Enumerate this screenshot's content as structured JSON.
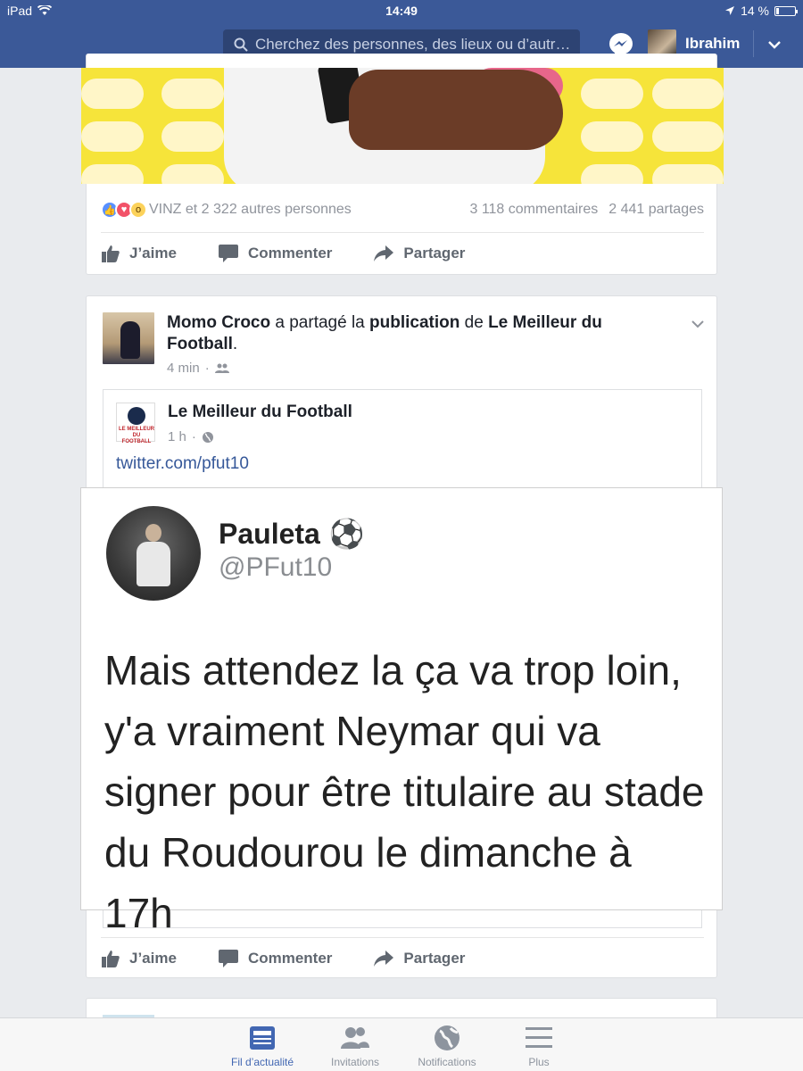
{
  "status_bar": {
    "device": "iPad",
    "time": "14:49",
    "battery": "14 %",
    "battery_level": 0.14
  },
  "nav": {
    "search_placeholder": "Cherchez des personnes, des lieux ou d’autr…",
    "user_name": "Ibrahim"
  },
  "post1": {
    "reactions_text": "VINZ et 2 322 autres personnes",
    "comments": "3 118 commentaires",
    "shares": "2 441 partages"
  },
  "actions": {
    "like": "J’aime",
    "comment": "Commenter",
    "share": "Partager"
  },
  "post2": {
    "author": "Momo Croco",
    "verb1": "a partagé la",
    "object": "publication",
    "verb2": "de",
    "page": "Le Meilleur du Football",
    "time": "4 min",
    "separator": "·"
  },
  "shared": {
    "page_name": "Le Meilleur du Football",
    "logo_text": "LE MEILLEUR DU FOOTBALL",
    "time": "1 h",
    "separator": "·",
    "link": "twitter.com/pfut10"
  },
  "tweet": {
    "name": "Pauleta",
    "emoji": "⚽",
    "handle": "@PFut10",
    "text": "Mais attendez la ça va trop loin, y'a vraiment Neymar qui va signer pour être titulaire au stade du Roudourou le dimanche à 17h"
  },
  "tabbar": {
    "tabs": [
      "Fil d’actualité",
      "Invitations",
      "Notifications",
      "Plus"
    ],
    "active_color": "#4267b2",
    "inactive_color": "#8d949e"
  },
  "colors": {
    "brand": "#3b5998",
    "link": "#365899"
  }
}
